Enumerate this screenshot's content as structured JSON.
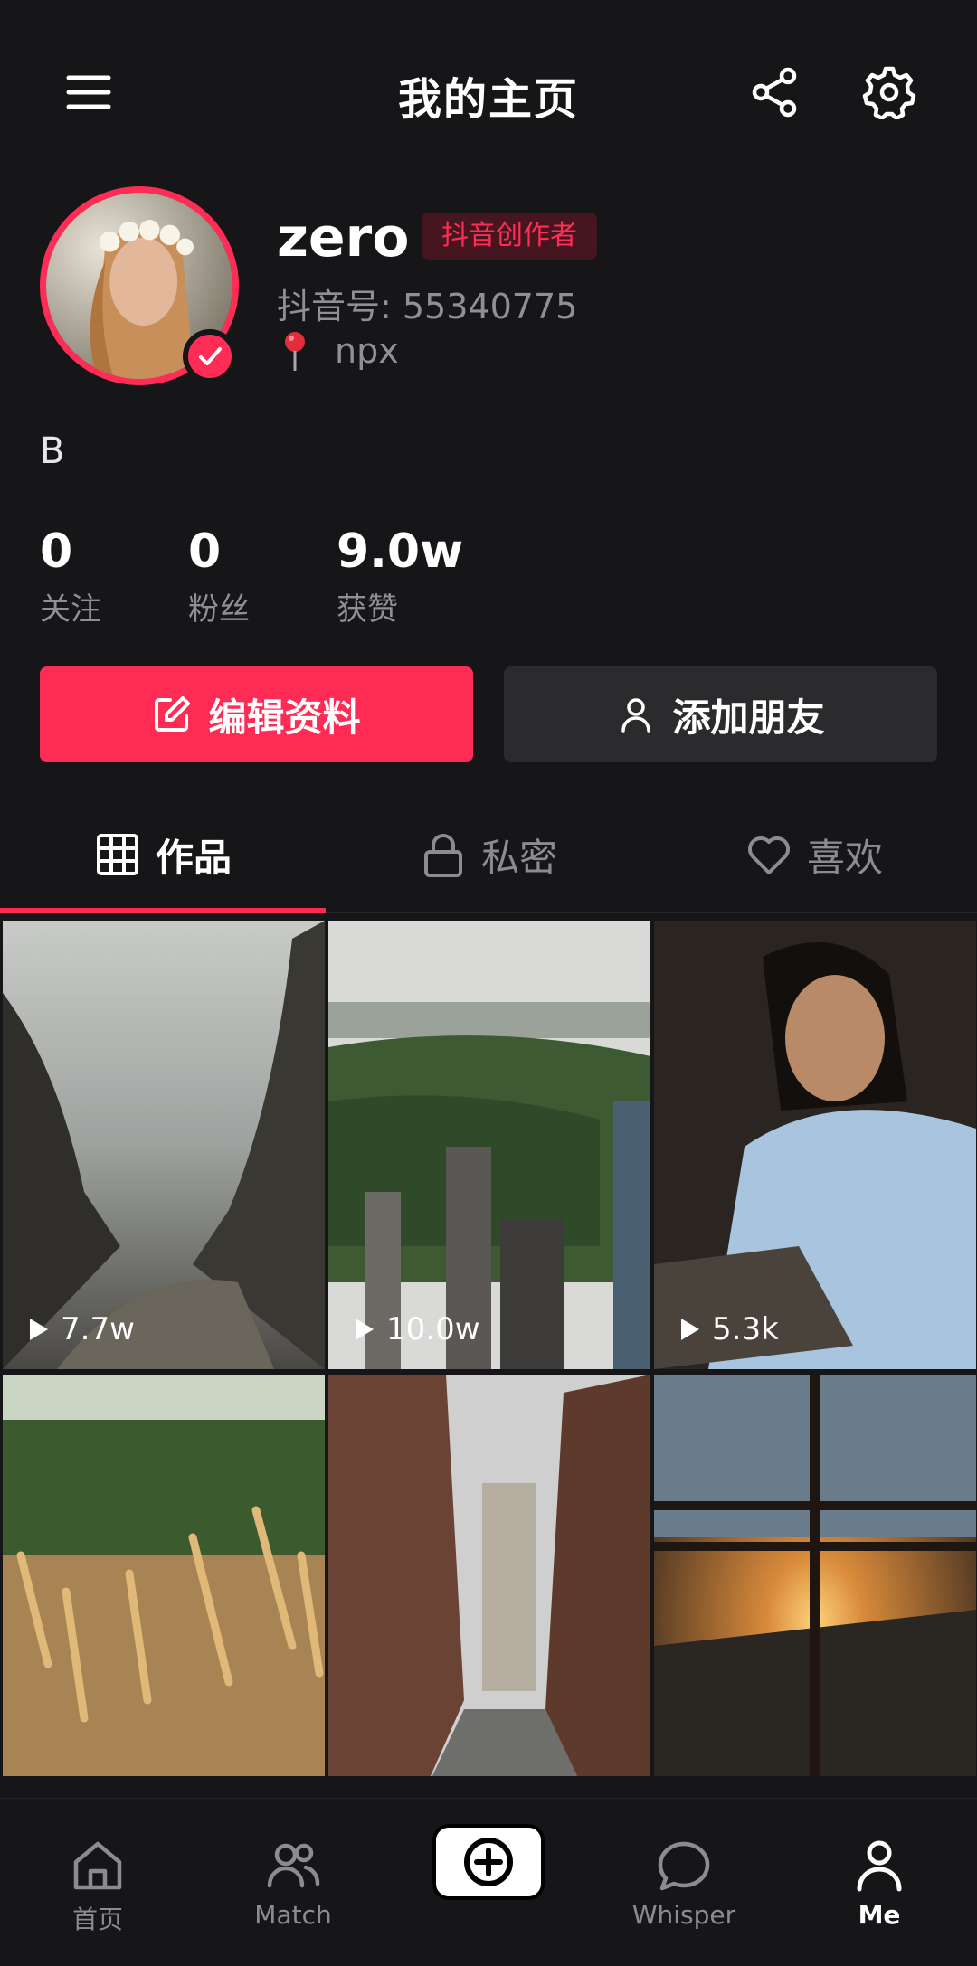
{
  "header": {
    "title": "我的主页",
    "menu_icon": "menu-icon",
    "share_icon": "share-icon",
    "settings_icon": "gear-icon"
  },
  "profile": {
    "username": "zero",
    "badge": "抖音创作者",
    "douyin_id": "抖音号: 55340775",
    "location": "npx",
    "bio": "B"
  },
  "stats": [
    {
      "value": "0",
      "label": "关注"
    },
    {
      "value": "0",
      "label": "粉丝"
    },
    {
      "value": "9.0w",
      "label": "获赞"
    }
  ],
  "actions": {
    "edit_label": "编辑资料",
    "add_friend_label": "添加朋友"
  },
  "tabs": [
    {
      "label": "作品",
      "icon": "grid-icon",
      "active": true
    },
    {
      "label": "私密",
      "icon": "lock-icon",
      "active": false
    },
    {
      "label": "喜欢",
      "icon": "heart-icon",
      "active": false
    }
  ],
  "videos": [
    {
      "plays": "7.7w",
      "scene": "misty canyon"
    },
    {
      "plays": "10.0w",
      "scene": "city park aerial"
    },
    {
      "plays": "5.3k",
      "scene": "woman reading"
    },
    {
      "plays": "",
      "scene": "wheat field"
    },
    {
      "plays": "",
      "scene": "brick alley"
    },
    {
      "plays": "",
      "scene": "sunset window"
    }
  ],
  "bottom_nav": [
    {
      "label": "首页",
      "icon": "home-icon"
    },
    {
      "label": "Match",
      "icon": "users-icon"
    },
    {
      "label": "",
      "icon": "plus-icon"
    },
    {
      "label": "Whisper",
      "icon": "chat-bubble-icon"
    },
    {
      "label": "Me",
      "icon": "person-icon"
    }
  ],
  "colors": {
    "accent": "#fe2c55",
    "background": "#161618",
    "muted_text": "#909094"
  }
}
